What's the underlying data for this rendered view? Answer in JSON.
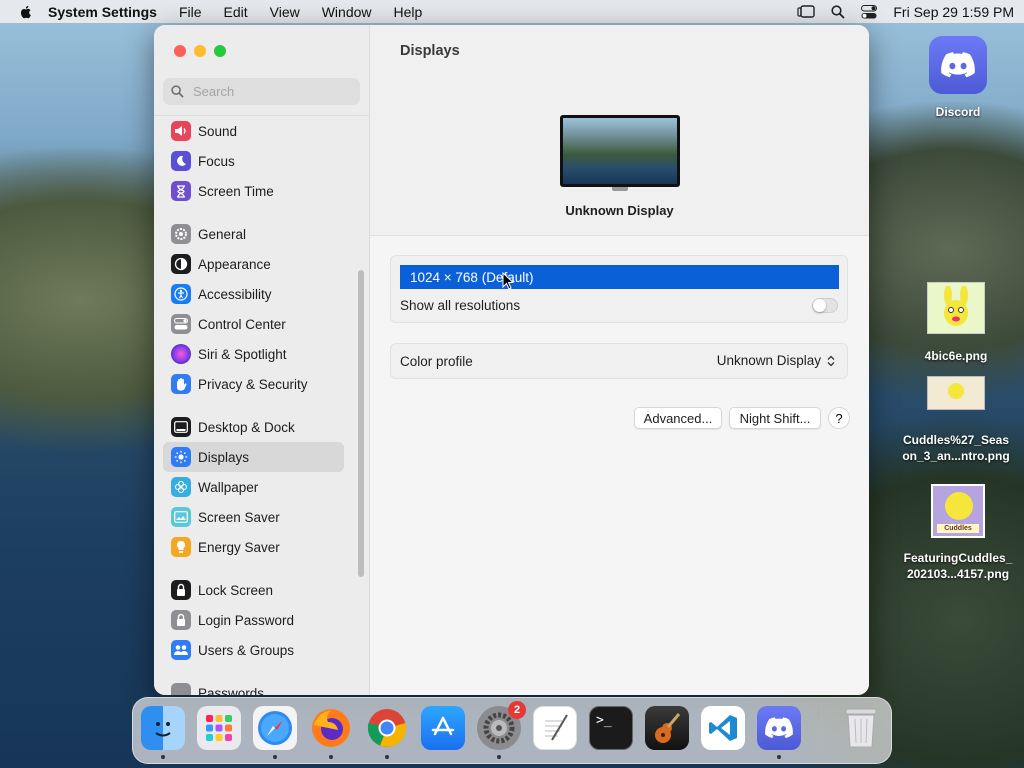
{
  "menubar": {
    "app_name": "System Settings",
    "menus": [
      "File",
      "Edit",
      "View",
      "Window",
      "Help"
    ],
    "clock": "Fri Sep 29  1:59 PM"
  },
  "sidebar": {
    "search_placeholder": "Search",
    "items": [
      {
        "label": "Sound",
        "icon": "sound-icon",
        "color": "#e8455a"
      },
      {
        "label": "Focus",
        "icon": "focus-moon-icon",
        "color": "#5b4fd6"
      },
      {
        "label": "Screen Time",
        "icon": "hourglass-icon",
        "color": "#6e4fd2"
      },
      {
        "label": "General",
        "icon": "gear-icon",
        "color": "#8e8e93"
      },
      {
        "label": "Appearance",
        "icon": "appearance-icon",
        "color": "#1c1c1e"
      },
      {
        "label": "Accessibility",
        "icon": "accessibility-icon",
        "color": "#1a7cf2"
      },
      {
        "label": "Control Center",
        "icon": "control-center-icon",
        "color": "#8e8e93"
      },
      {
        "label": "Siri & Spotlight",
        "icon": "siri-icon",
        "color": "#b43cd2"
      },
      {
        "label": "Privacy & Security",
        "icon": "hand-icon",
        "color": "#2f7cf5"
      },
      {
        "label": "Desktop & Dock",
        "icon": "dock-icon",
        "color": "#1c1c1e"
      },
      {
        "label": "Displays",
        "icon": "brightness-icon",
        "color": "#2f7cf5"
      },
      {
        "label": "Wallpaper",
        "icon": "wallpaper-icon",
        "color": "#35aee0"
      },
      {
        "label": "Screen Saver",
        "icon": "screen-saver-icon",
        "color": "#5ac8d8"
      },
      {
        "label": "Energy Saver",
        "icon": "battery-icon",
        "color": "#f5a623"
      },
      {
        "label": "Lock Screen",
        "icon": "lock-icon",
        "color": "#1c1c1e"
      },
      {
        "label": "Login Password",
        "icon": "key-lock-icon",
        "color": "#8e8e93"
      },
      {
        "label": "Users & Groups",
        "icon": "users-icon",
        "color": "#2f7cf5"
      },
      {
        "label": "Passwords",
        "icon": "key-icon",
        "color": "#8e8e93"
      }
    ],
    "selected": "Displays"
  },
  "content": {
    "title": "Displays",
    "display_name": "Unknown Display",
    "resolution": "1024 × 768 (Default)",
    "show_all_label": "Show all resolutions",
    "show_all_on": false,
    "color_profile_label": "Color profile",
    "color_profile_value": "Unknown Display",
    "advanced_label": "Advanced...",
    "night_shift_label": "Night Shift...",
    "help_label": "?"
  },
  "desktop": {
    "discord_label": "Discord",
    "file1_label": "4bic6e.png",
    "file2_line1": "Cuddles%27_Seas",
    "file2_line2": "on_3_an...ntro.png",
    "file3_line1": "FeaturingCuddles_",
    "file3_line2": "202103...4157.png",
    "file3_thumb_text": "Cuddles"
  },
  "dock": {
    "apps": [
      "Finder",
      "Launchpad",
      "Safari",
      "Firefox",
      "Chrome",
      "App Store",
      "System Settings",
      "TextEdit",
      "Terminal",
      "GarageBand",
      "Visual Studio Code",
      "Discord",
      "Trash"
    ],
    "settings_badge": "2",
    "terminal_prompt": ">_"
  }
}
